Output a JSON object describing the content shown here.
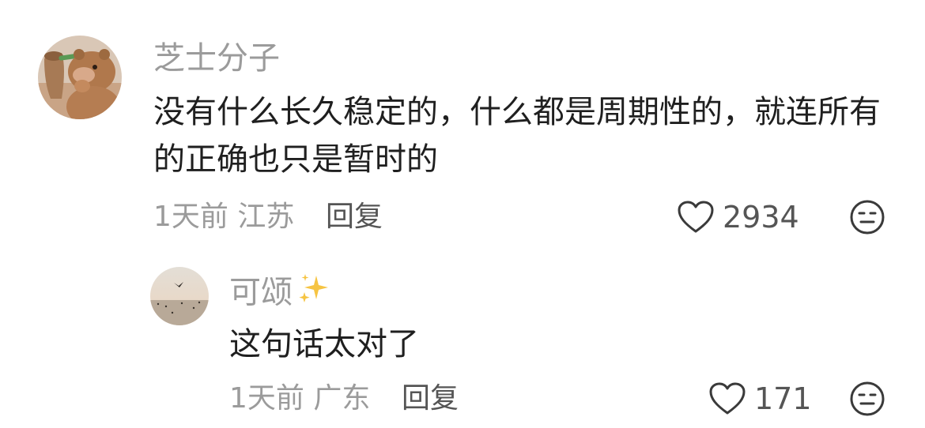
{
  "comments": [
    {
      "username": "芝士分子",
      "avatar": "bear-avatar",
      "text": "没有什么长久稳定的，什么都是周期性的，就连所有的正确也只是暂时的",
      "time": "1天前",
      "location": "江苏",
      "reply_label": "回复",
      "likes": "2934",
      "like_icon": "heart-outline-icon",
      "dislike_icon": "meh-face-icon"
    },
    {
      "username": "可颂",
      "username_emoji": "sparkles-icon",
      "avatar": "sunset-bird-avatar",
      "text": "这句话太对了",
      "time": "1天前",
      "location": "广东",
      "reply_label": "回复",
      "likes": "171",
      "like_icon": "heart-outline-icon",
      "dislike_icon": "meh-face-icon"
    }
  ],
  "colors": {
    "muted_text": "#9b9b9b",
    "body_text": "#1f1f1f",
    "action_text": "#555555",
    "sparkle": "#f6c443"
  }
}
